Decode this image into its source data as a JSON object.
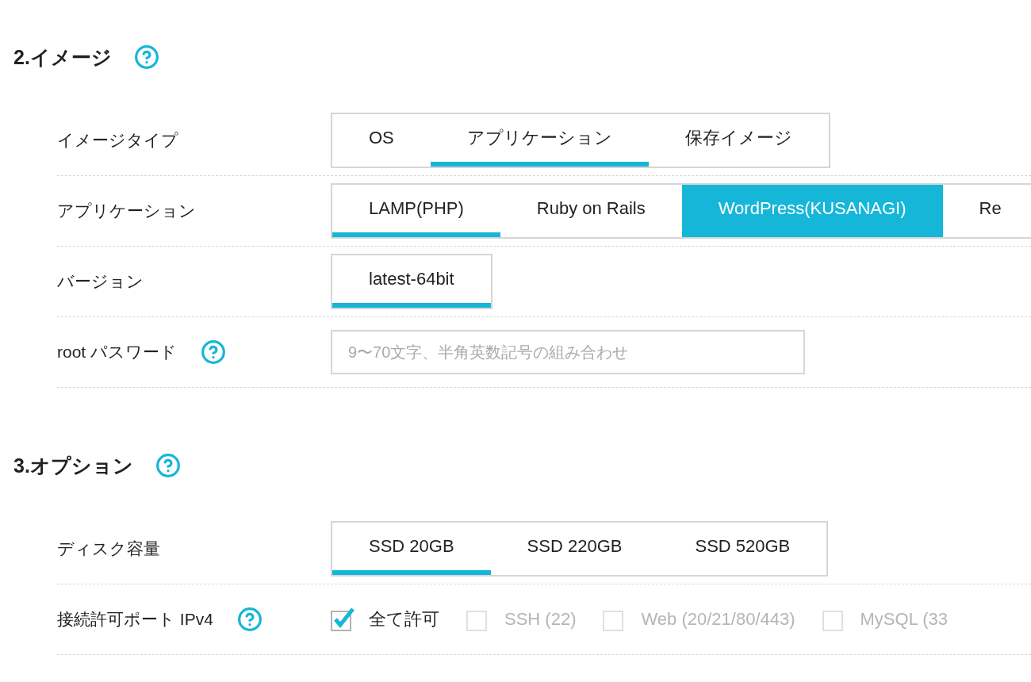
{
  "sections": [
    {
      "title": "2.イメージ",
      "rows": [
        {
          "kind": "tabs",
          "label": "イメージタイプ",
          "tabs": [
            {
              "label": "OS",
              "selected": false,
              "filled": false
            },
            {
              "label": "アプリケーション",
              "selected": true,
              "filled": false
            },
            {
              "label": "保存イメージ",
              "selected": false,
              "filled": false
            }
          ]
        },
        {
          "kind": "tabs",
          "label": "アプリケーション",
          "tabs": [
            {
              "label": "LAMP(PHP)",
              "selected": true,
              "filled": false
            },
            {
              "label": "Ruby on Rails",
              "selected": false,
              "filled": false
            },
            {
              "label": "WordPress(KUSANAGI)",
              "selected": false,
              "filled": true
            },
            {
              "label": "Re",
              "selected": false,
              "filled": false
            }
          ]
        },
        {
          "kind": "tabs",
          "label": "バージョン",
          "tabs": [
            {
              "label": "latest-64bit",
              "selected": true,
              "filled": false
            }
          ]
        },
        {
          "kind": "input",
          "label": "root パスワード",
          "help": true,
          "placeholder": "9〜70文字、半角英数記号の組み合わせ"
        }
      ]
    },
    {
      "title": "3.オプション",
      "rows": [
        {
          "kind": "tabs",
          "label": "ディスク容量",
          "tabs": [
            {
              "label": "SSD 20GB",
              "selected": true,
              "filled": false
            },
            {
              "label": "SSD 220GB",
              "selected": false,
              "filled": false
            },
            {
              "label": "SSD 520GB",
              "selected": false,
              "filled": false
            }
          ]
        },
        {
          "kind": "checks",
          "label": "接続許可ポート IPv4",
          "help": true,
          "options": [
            {
              "label": "全て許可",
              "checked": true,
              "disabled": false
            },
            {
              "label": "SSH (22)",
              "checked": false,
              "disabled": true
            },
            {
              "label": "Web (20/21/80/443)",
              "checked": false,
              "disabled": true
            },
            {
              "label": "MySQL (33",
              "checked": false,
              "disabled": true
            }
          ]
        }
      ]
    }
  ]
}
